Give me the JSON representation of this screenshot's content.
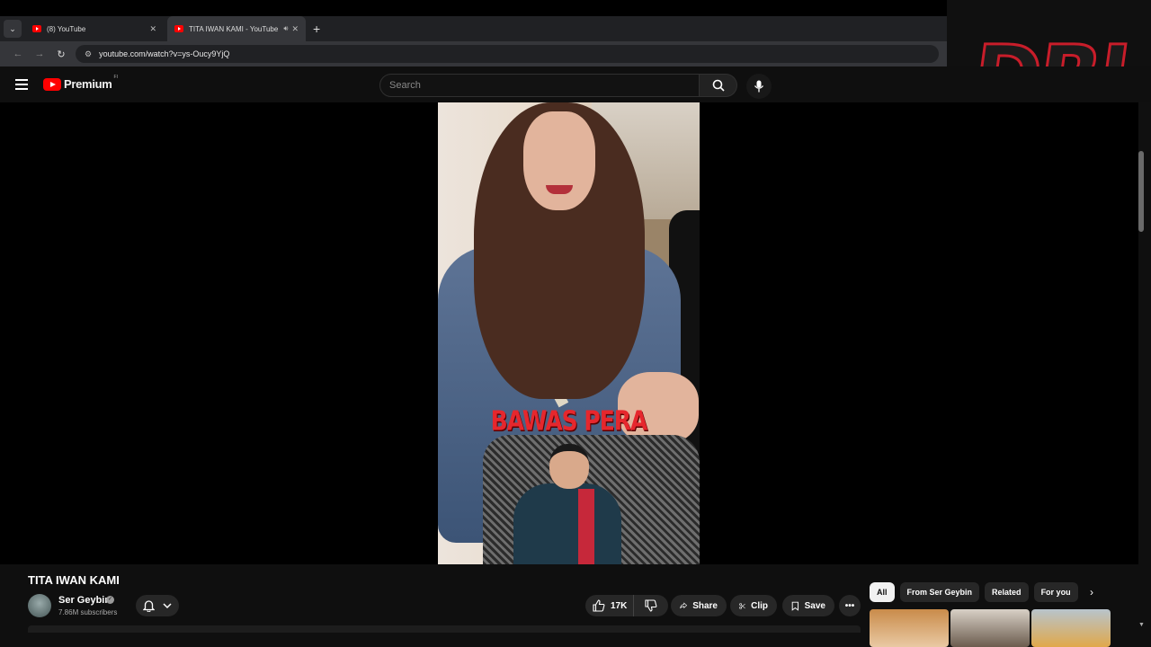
{
  "browser": {
    "tabs": [
      {
        "title": "(8) YouTube",
        "active": false
      },
      {
        "title": "TITA IWAN KAMI - YouTube",
        "active": true
      }
    ],
    "url": "youtube.com/watch?v=ys-Oucy9YjQ"
  },
  "header": {
    "logo_text": "Premium",
    "region": "FI",
    "search_placeholder": "Search"
  },
  "overlay": {
    "watermark": "DRJ"
  },
  "video": {
    "caption": "BAWAS PERA",
    "title": "TITA IWAN KAMI"
  },
  "channel": {
    "name": "Ser Geybin",
    "subscribers": "7.86M subscribers"
  },
  "actions": {
    "likes": "17K",
    "share": "Share",
    "clip": "Clip",
    "save": "Save"
  },
  "chips": [
    "All",
    "From Ser Geybin",
    "Related",
    "For you"
  ],
  "colors": {
    "accent": "#ff0000",
    "watermark_stroke": "#c81d2a",
    "caption": "#e6272d"
  }
}
